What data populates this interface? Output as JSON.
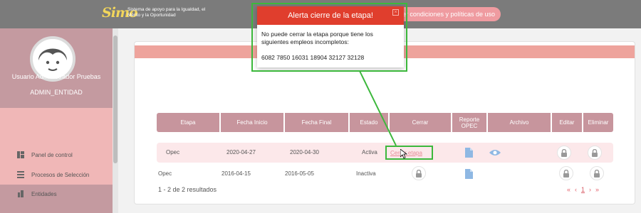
{
  "header": {
    "logo_mark": "Simo",
    "logo_text": "Sistema de apoyo para la Igualdad, el Mérito y la Oportunidad",
    "terms_label": "Ver condiciones y políticas de uso"
  },
  "sidebar": {
    "user_name": "Usuario Administrador Pruebas",
    "user_role": "ADMIN_ENTIDAD",
    "items": [
      {
        "label": "Panel de control",
        "icon": "dashboard-icon"
      },
      {
        "label": "Procesos de Selección",
        "icon": "list-icon"
      },
      {
        "label": "Entidades",
        "icon": "building-icon"
      }
    ]
  },
  "table": {
    "columns": [
      "Etapa",
      "Fecha Inicio",
      "Fecha Final",
      "Estado",
      "Cerrar",
      "Reporte OPEC",
      "Archivo",
      "Editar",
      "Eliminar"
    ],
    "rows": [
      {
        "etapa": "Opec",
        "inicio": "2020-04-27",
        "final": "2020-04-30",
        "estado": "Activa",
        "cerrar": "Cerrar etapa"
      },
      {
        "etapa": "Opec",
        "inicio": "2016-04-15",
        "final": "2016-05-05",
        "estado": "Inactiva",
        "cerrar": ""
      }
    ],
    "results_text": "1 - 2 de 2 resultados",
    "pager": {
      "first": "«",
      "prev": "‹",
      "current": "1",
      "next": "›",
      "last": "»"
    }
  },
  "alert": {
    "title": "Alerta cierre de la etapa!",
    "message": "No puede cerrar la etapa porque tiene los siguientes empleos incompletos:",
    "codes": "6082 7850 16031 18904 32127 32128",
    "close_symbol": "×"
  },
  "colors": {
    "topbar": "#7b7b7b",
    "sidebar": "#c49aa0",
    "table_header": "#c7959d",
    "alert_title": "#e03e2d",
    "highlight": "#3cb83c",
    "link": "#e58b96"
  }
}
